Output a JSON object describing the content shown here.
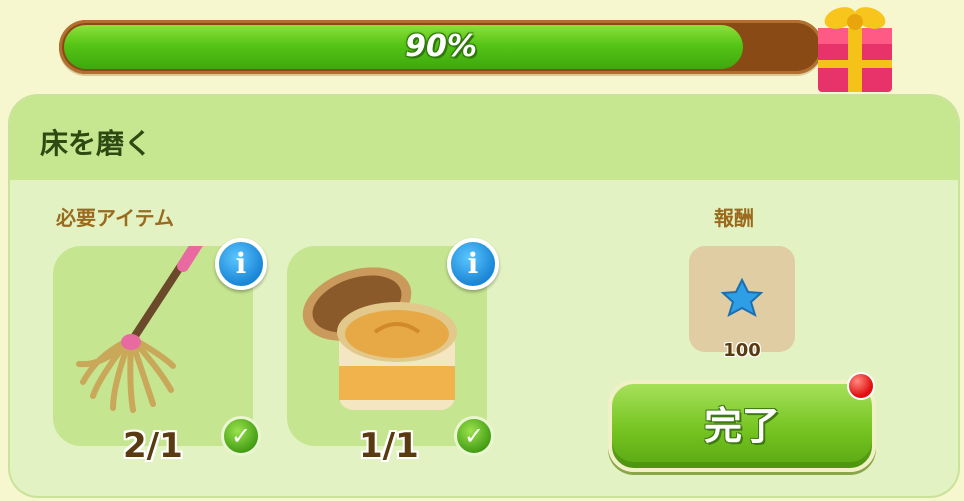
{
  "progress": {
    "label": "90%",
    "value": 0.9
  },
  "task": {
    "title": "床を磨く"
  },
  "required": {
    "label": "必要アイテム",
    "items": [
      {
        "icon": "mop-icon",
        "count": "2/1",
        "info": "i"
      },
      {
        "icon": "polish-jar-icon",
        "count": "1/1",
        "info": "i"
      }
    ]
  },
  "reward": {
    "label": "報酬",
    "icon": "blue-star-icon",
    "value": "100"
  },
  "complete_button": {
    "label": "完了"
  },
  "colors": {
    "accent": "#75c421",
    "progress_fill": "#55c516",
    "notification": "#e01010"
  }
}
